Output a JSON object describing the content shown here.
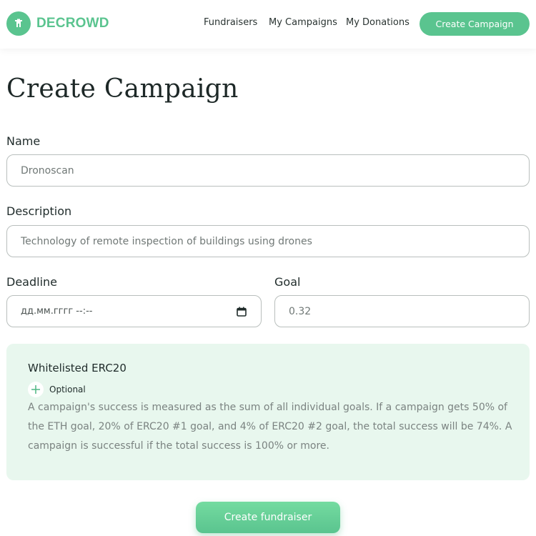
{
  "header": {
    "brand": "DECROWD",
    "nav": {
      "fundraisers": "Fundraisers",
      "my_campaigns": "My Campaigns",
      "my_donations": "My Donations"
    },
    "cta_label": "Create Campaign"
  },
  "page_title": "Create Campaign",
  "form": {
    "name_label": "Name",
    "name_value": "Dronoscan",
    "description_label": "Description",
    "description_value": "Technology of remote inspection of buildings using drones",
    "deadline_label": "Deadline",
    "deadline_placeholder": "дд.мм.гггг --:--",
    "goal_label": "Goal",
    "goal_value": "0.32"
  },
  "whitelist": {
    "title": "Whitelisted ERC20",
    "add_label": "Optional",
    "description": "A campaign's success is measured as the sum of all individual goals. If a campaign gets 50% of the ETH goal, 20% of ERC20 #1 goal, and 4% of ERC20 #2 goal, the total success will be 74%. A campaign is successful if the total success is 100% or more."
  },
  "submit_label": "Create fundraiser",
  "colors": {
    "accent": "#5ac48f",
    "panel_bg": "#e8f7ee"
  },
  "icons": {
    "logo": "bell-icon",
    "calendar": "calendar-icon",
    "add": "plus-icon"
  }
}
